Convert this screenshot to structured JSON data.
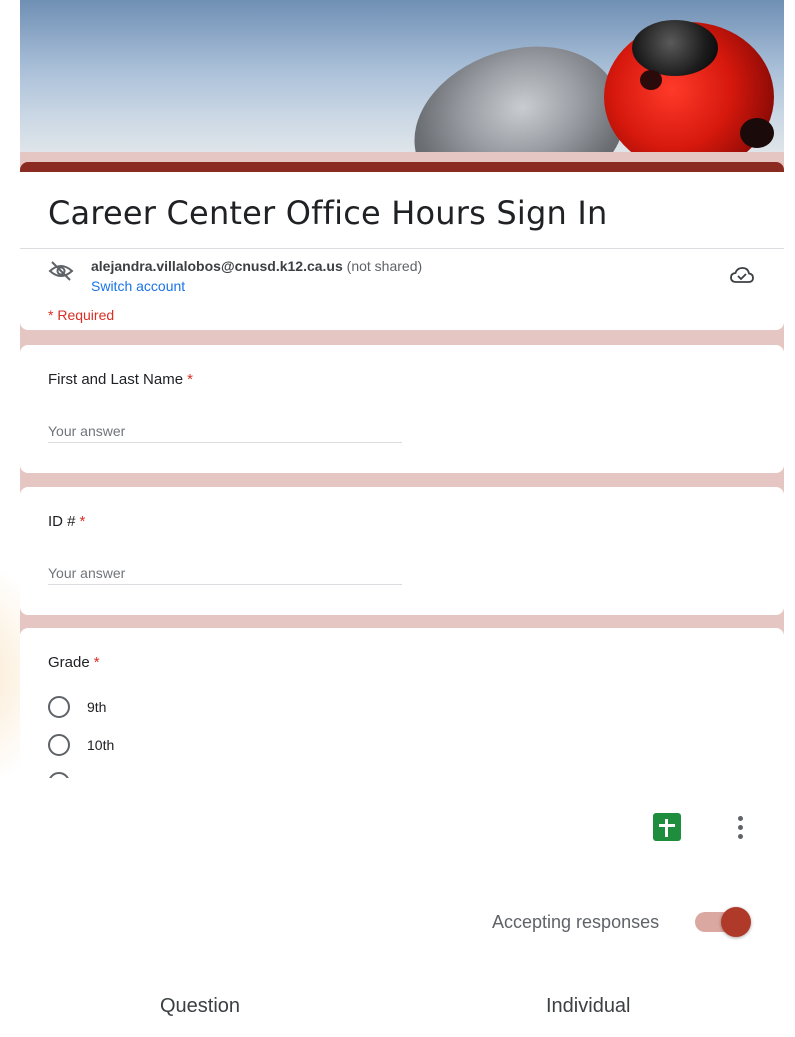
{
  "form": {
    "title": "Career Center Office Hours Sign In",
    "account": {
      "email": "alejandra.villalobos@cnusd.k12.ca.us",
      "sharing": "(not shared)",
      "switch_label": "Switch account"
    },
    "required_note": "* Required",
    "questions": [
      {
        "label": "First and Last Name",
        "required_mark": "*",
        "placeholder": "Your answer"
      },
      {
        "label": "ID #",
        "required_mark": "*",
        "placeholder": "Your answer"
      },
      {
        "label": "Grade",
        "required_mark": "*",
        "options": [
          "9th",
          "10th"
        ]
      }
    ]
  },
  "toolbar": {
    "sheets_icon": "google-sheets-icon",
    "more_icon": "more-vertical-icon",
    "accepting_label": "Accepting responses",
    "accepting_on": true
  },
  "tabs": [
    {
      "label": "Question"
    },
    {
      "label": "Individual"
    }
  ],
  "colors": {
    "accent": "#8a2a20",
    "toggle_thumb": "#b03a2a",
    "required": "#d93025",
    "link": "#1a73e8",
    "sheets": "#1e8e3e"
  }
}
